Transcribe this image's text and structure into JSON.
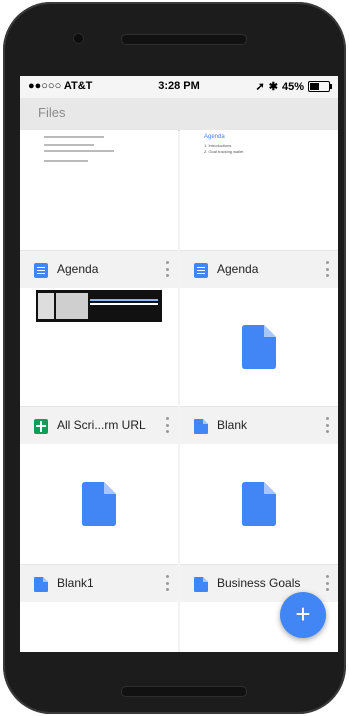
{
  "status_bar": {
    "carrier": "●●○○○ AT&T",
    "time": "3:28 PM",
    "battery": "45%"
  },
  "app_bar": {
    "title": "Files"
  },
  "files": [
    {
      "name": "Agenda",
      "type": "doc"
    },
    {
      "name": "Agenda",
      "type": "doc"
    },
    {
      "name": "All Scri...rm URL",
      "type": "sheet"
    },
    {
      "name": "Blank",
      "type": "doc"
    },
    {
      "name": "Blank1",
      "type": "doc"
    },
    {
      "name": "Business Goals",
      "type": "doc"
    }
  ],
  "preview_text": {
    "agenda_heading": "Agenda",
    "agenda_item1": "1. Introductions",
    "agenda_item2": "2. Goal tracking wallet"
  },
  "fab": {
    "label": "+"
  },
  "colors": {
    "docs_blue": "#4285f4",
    "sheets_green": "#0f9d58"
  }
}
